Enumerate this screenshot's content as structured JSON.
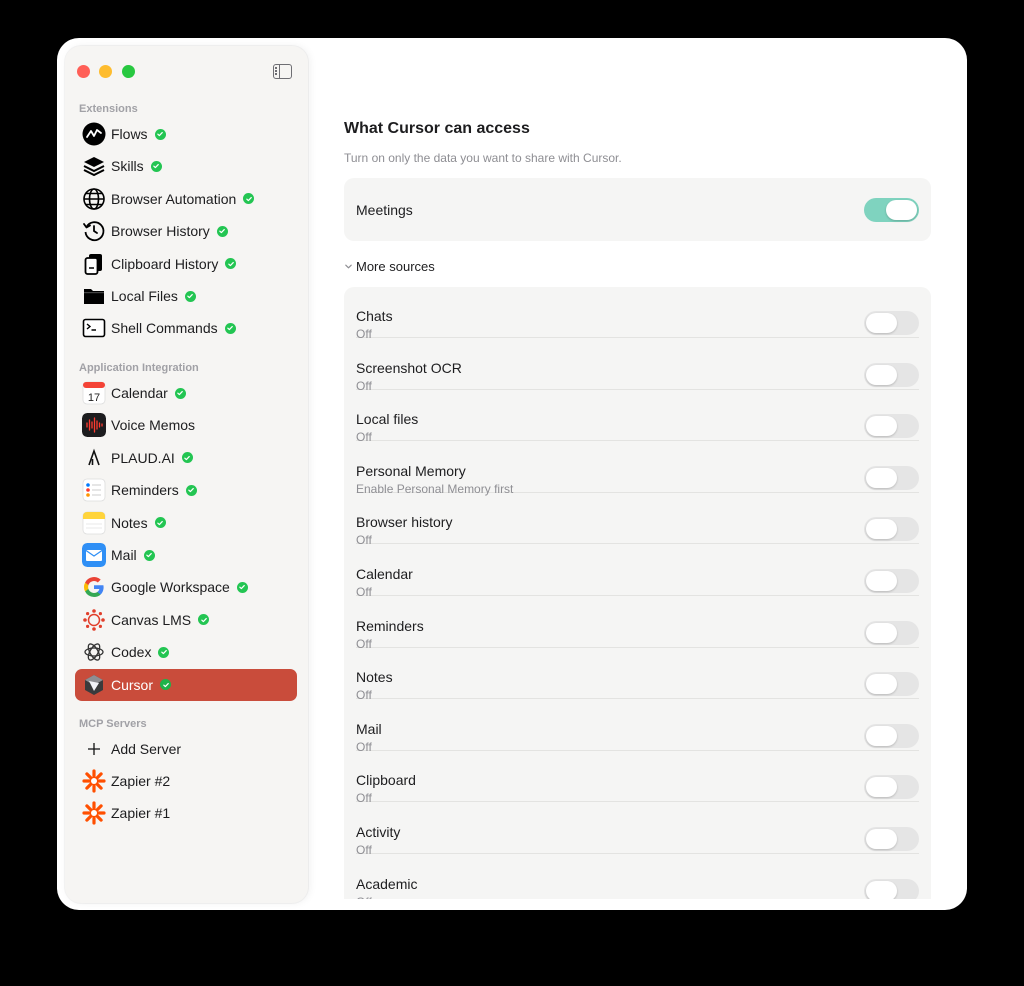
{
  "sidebar": {
    "sections": {
      "extensions": "Extensions",
      "app_integration": "Application Integration",
      "mcp_servers": "MCP Servers"
    },
    "extensions": [
      {
        "label": "Flows",
        "icon": "flows-icon",
        "connected": true
      },
      {
        "label": "Skills",
        "icon": "skills-icon",
        "connected": true
      },
      {
        "label": "Browser Automation",
        "icon": "globe-icon",
        "connected": true
      },
      {
        "label": "Browser History",
        "icon": "history-icon",
        "connected": true
      },
      {
        "label": "Clipboard History",
        "icon": "clipboard-icon",
        "connected": true
      },
      {
        "label": "Local Files",
        "icon": "folder-icon",
        "connected": true
      },
      {
        "label": "Shell Commands",
        "icon": "terminal-icon",
        "connected": true
      }
    ],
    "apps": [
      {
        "label": "Calendar",
        "icon": "calendar-icon",
        "connected": true,
        "calendar_day": "17"
      },
      {
        "label": "Voice Memos",
        "icon": "voice-memos-icon",
        "connected": false
      },
      {
        "label": "PLAUD.AI",
        "icon": "plaud-icon",
        "connected": true
      },
      {
        "label": "Reminders",
        "icon": "reminders-icon",
        "connected": true
      },
      {
        "label": "Notes",
        "icon": "notes-icon",
        "connected": true
      },
      {
        "label": "Mail",
        "icon": "mail-icon",
        "connected": true
      },
      {
        "label": "Google Workspace",
        "icon": "google-icon",
        "connected": true
      },
      {
        "label": "Canvas LMS",
        "icon": "canvas-icon",
        "connected": true
      },
      {
        "label": "Codex",
        "icon": "codex-icon",
        "connected": true
      },
      {
        "label": "Cursor",
        "icon": "cursor-icon",
        "connected": true,
        "active": true
      }
    ],
    "mcp": [
      {
        "label": "Add Server",
        "icon": "plus-icon"
      },
      {
        "label": "Zapier #2",
        "icon": "zapier-icon"
      },
      {
        "label": "Zapier #1",
        "icon": "zapier-icon"
      }
    ]
  },
  "main": {
    "title": "What Cursor can access",
    "subtitle": "Turn on only the data you want to share with Cursor.",
    "meetings": {
      "label": "Meetings",
      "on": true
    },
    "more_sources_label": "More sources",
    "sources": [
      {
        "name": "Chats",
        "status": "Off"
      },
      {
        "name": "Screenshot OCR",
        "status": "Off"
      },
      {
        "name": "Local files",
        "status": "Off"
      },
      {
        "name": "Personal Memory",
        "status": "Enable Personal Memory first"
      },
      {
        "name": "Browser history",
        "status": "Off"
      },
      {
        "name": "Calendar",
        "status": "Off"
      },
      {
        "name": "Reminders",
        "status": "Off"
      },
      {
        "name": "Notes",
        "status": "Off"
      },
      {
        "name": "Mail",
        "status": "Off"
      },
      {
        "name": "Clipboard",
        "status": "Off"
      },
      {
        "name": "Activity",
        "status": "Off"
      },
      {
        "name": "Academic",
        "status": "Off"
      }
    ]
  },
  "colors": {
    "accent_active": "#c94c3b",
    "check_green": "#23c552",
    "toggle_on": "#7fd3bf",
    "toggle_off": "#e5e5e5"
  }
}
